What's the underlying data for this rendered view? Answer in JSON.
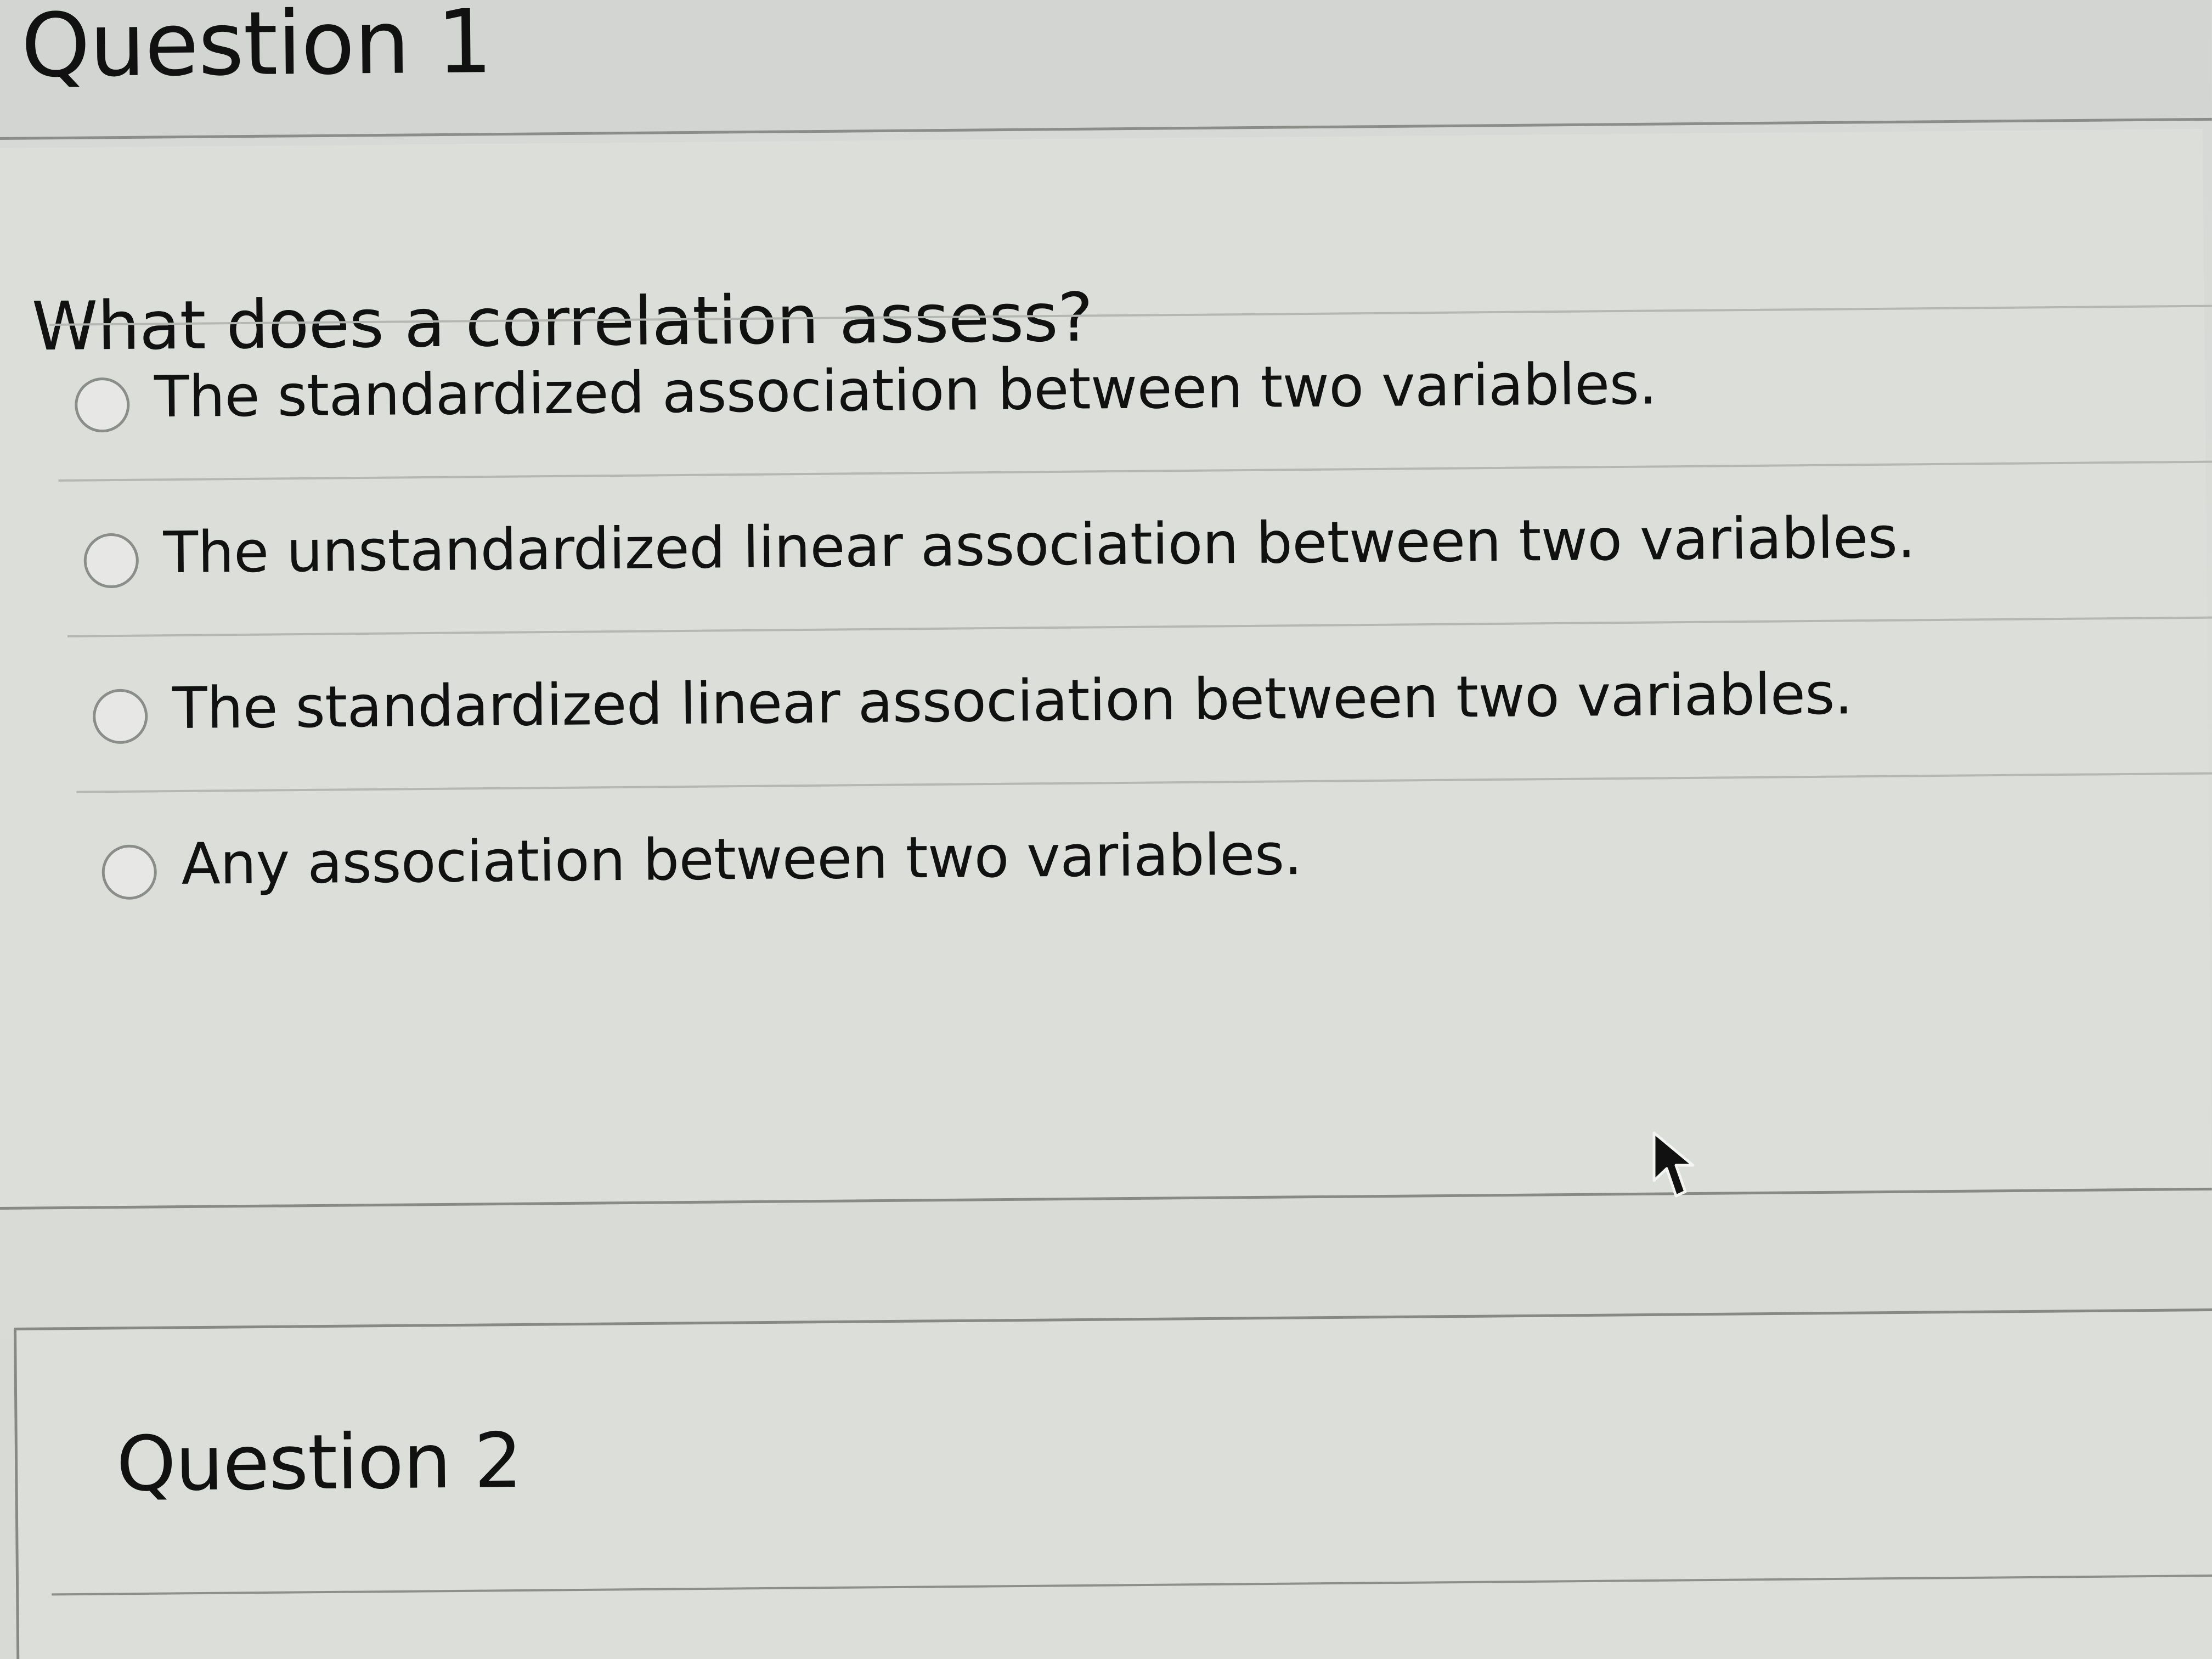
{
  "question1": {
    "title": "Question 1",
    "prompt": "What does a correlation assess?",
    "options": [
      {
        "label": "The standardized association between two variables."
      },
      {
        "label": "The unstandardized linear association between two variables."
      },
      {
        "label": "The standardized linear association between two variables."
      },
      {
        "label": "Any association between two variables."
      }
    ]
  },
  "question2": {
    "title": "Question 2"
  },
  "icons": {
    "radio": "radio-button-icon",
    "cursor": "mouse-pointer-icon"
  }
}
